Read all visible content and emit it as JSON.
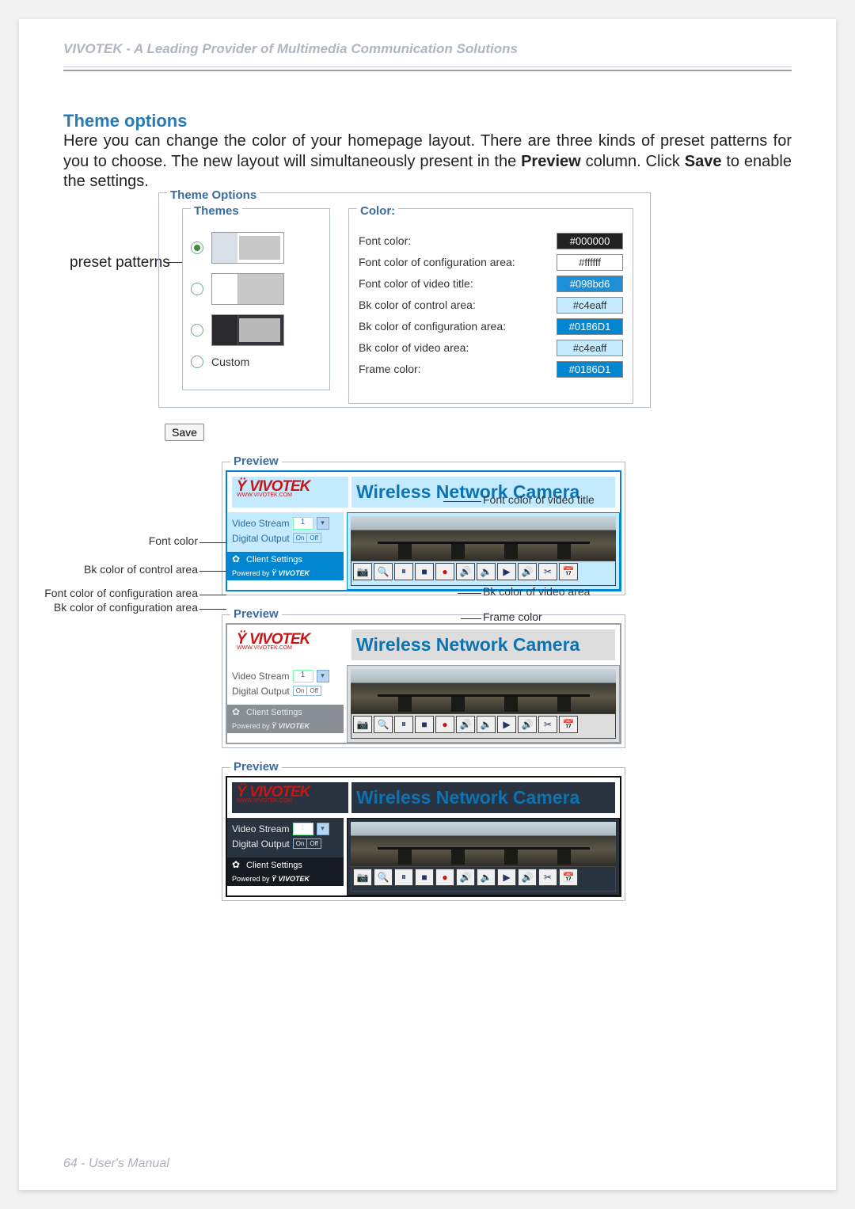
{
  "header": {
    "title": "VIVOTEK - A Leading Provider of Multimedia Communication Solutions"
  },
  "section": {
    "title": "Theme options",
    "intro_part1": "Here you can change the color of your homepage layout. There are three kinds of preset patterns for you to choose. The new layout will simultaneously present in the ",
    "intro_bold1": "Preview",
    "intro_part2": " column. Click ",
    "intro_bold2": "Save",
    "intro_part3": " to enable the settings."
  },
  "labels": {
    "preset_patterns": "preset patterns",
    "save": "Save",
    "theme_options": "Theme Options",
    "themes": "Themes",
    "custom": "Custom",
    "color": "Color:"
  },
  "color_rows": [
    {
      "label": "Font color:",
      "value": "#000000",
      "bg": "#222",
      "fg": "#fff"
    },
    {
      "label": "Font color of configuration area:",
      "value": "#ffffff",
      "bg": "#fff",
      "fg": "#333"
    },
    {
      "label": "Font color of video title:",
      "value": "#098bd6",
      "bg": "#1d8fd7",
      "fg": "#fff"
    },
    {
      "label": "Bk color of control area:",
      "value": "#c4eaff",
      "bg": "#c4eaff",
      "fg": "#333"
    },
    {
      "label": "Bk color of configuration area:",
      "value": "#0186D1",
      "bg": "#0186D1",
      "fg": "#fff"
    },
    {
      "label": "Bk color of video area:",
      "value": "#c4eaff",
      "bg": "#c4eaff",
      "fg": "#333"
    },
    {
      "label": "Frame color:",
      "value": "#0186D1",
      "bg": "#0186D1",
      "fg": "#fff"
    }
  ],
  "preview": {
    "legend": "Preview",
    "brand": "VIVOTEK",
    "brand_sub": "WWW.VIVOTEK.COM",
    "page_title": "Wireless Network Camera",
    "video_stream_label": "Video Stream",
    "video_stream_value": "1",
    "digital_output_label": "Digital Output",
    "on": "On",
    "off": "Off",
    "client_settings": "Client Settings",
    "powered_prefix": "Powered by ",
    "powered_brand": "VIVOTEK"
  },
  "previews": [
    {
      "title_color": "#0b73b3",
      "logo_color": "#c81616",
      "control_bg": "#c4eaff",
      "control_fg": "#2d6b9b",
      "conf_bg": "#0186D1",
      "conf_fg": "#ffffff",
      "video_bg": "#c4eaff",
      "frame": "#0186D1"
    },
    {
      "title_color": "#0b73b3",
      "logo_color": "#c81616",
      "control_bg": "#ffffff",
      "control_fg": "#5b5b5b",
      "conf_bg": "#8a8f96",
      "conf_fg": "#e6e6e6",
      "video_bg": "#dddddd",
      "frame": "#9aa0a7"
    },
    {
      "title_color": "#0b73b3",
      "logo_color": "#c81616",
      "control_bg": "#2a3340",
      "control_fg": "#e9e9e9",
      "conf_bg": "#161a21",
      "conf_fg": "#ffffff",
      "video_bg": "#2a3340",
      "frame": "#111"
    }
  ],
  "annotations": {
    "font_color_video_title": "Font color of video title",
    "font_color": "Font color",
    "bk_control": "Bk color of control area",
    "font_conf": "Font color of configuration area",
    "bk_conf": "Bk color of configuration area",
    "bk_video": "Bk color of video area",
    "frame_color": "Frame color"
  },
  "toolbar_icons": [
    "📷",
    "🔍",
    "⏸",
    "■",
    "●",
    "🔊",
    "🔈",
    "▶",
    "🔊",
    "✂",
    "📅"
  ],
  "footer": "64 - User's Manual"
}
